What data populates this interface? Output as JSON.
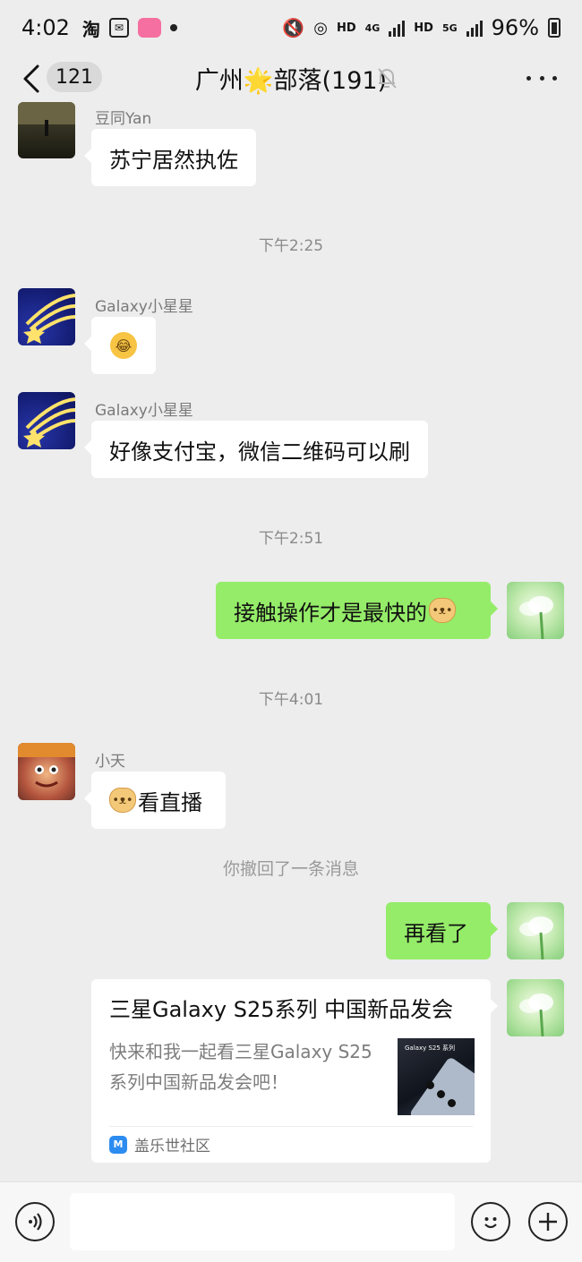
{
  "status_bar": {
    "time": "4:02",
    "left_icons": [
      "taobao-icon",
      "mail-icon",
      "bilibili-icon",
      "dot-icon"
    ],
    "taobao_label": "淘",
    "bilibili_label": "bilibili",
    "network_1": "HD",
    "network_1_type": "4G",
    "network_2": "HD",
    "network_2_type": "5G",
    "battery": "96%"
  },
  "header": {
    "unread_count": "121",
    "title": "广州🌟部落(191)"
  },
  "messages": [
    {
      "type": "incoming",
      "sender": "豆同Yan",
      "text": "苏宁居然执佐",
      "avatar": "dark-landscape"
    },
    {
      "type": "time",
      "text": "下午2:25"
    },
    {
      "type": "incoming",
      "sender": "Galaxy小星星",
      "text": "",
      "emoji": "face-with-tears-of-joy",
      "avatar": "shooting-star"
    },
    {
      "type": "incoming",
      "sender": "Galaxy小星星",
      "text": "好像支付宝，微信二维码可以刷",
      "avatar": "shooting-star"
    },
    {
      "type": "time",
      "text": "下午2:51"
    },
    {
      "type": "outgoing",
      "text": "接触操作才是最快的",
      "emoji": "doge"
    },
    {
      "type": "time",
      "text": "下午4:01"
    },
    {
      "type": "incoming",
      "sender": "小天",
      "text": "看直播",
      "emoji": "doge",
      "avatar": "hero"
    },
    {
      "type": "system",
      "text": "你撤回了一条消息"
    },
    {
      "type": "outgoing",
      "text": "再看了"
    },
    {
      "type": "outgoing-card",
      "title": "三星Galaxy S25系列 中国新品发会",
      "description": "快来和我一起看三星Galaxy S25系列中国新品发会吧！",
      "thumbnail_text": "Galaxy S25 系列",
      "source": "盖乐世社区"
    }
  ],
  "input_bar": {
    "voice_icon": "voice-icon",
    "emoji_icon": "emoji-icon",
    "plus_icon": "plus-icon",
    "placeholder": ""
  },
  "colors": {
    "background": "#ededed",
    "outgoing_bubble": "#95ec69",
    "incoming_bubble": "#ffffff"
  }
}
